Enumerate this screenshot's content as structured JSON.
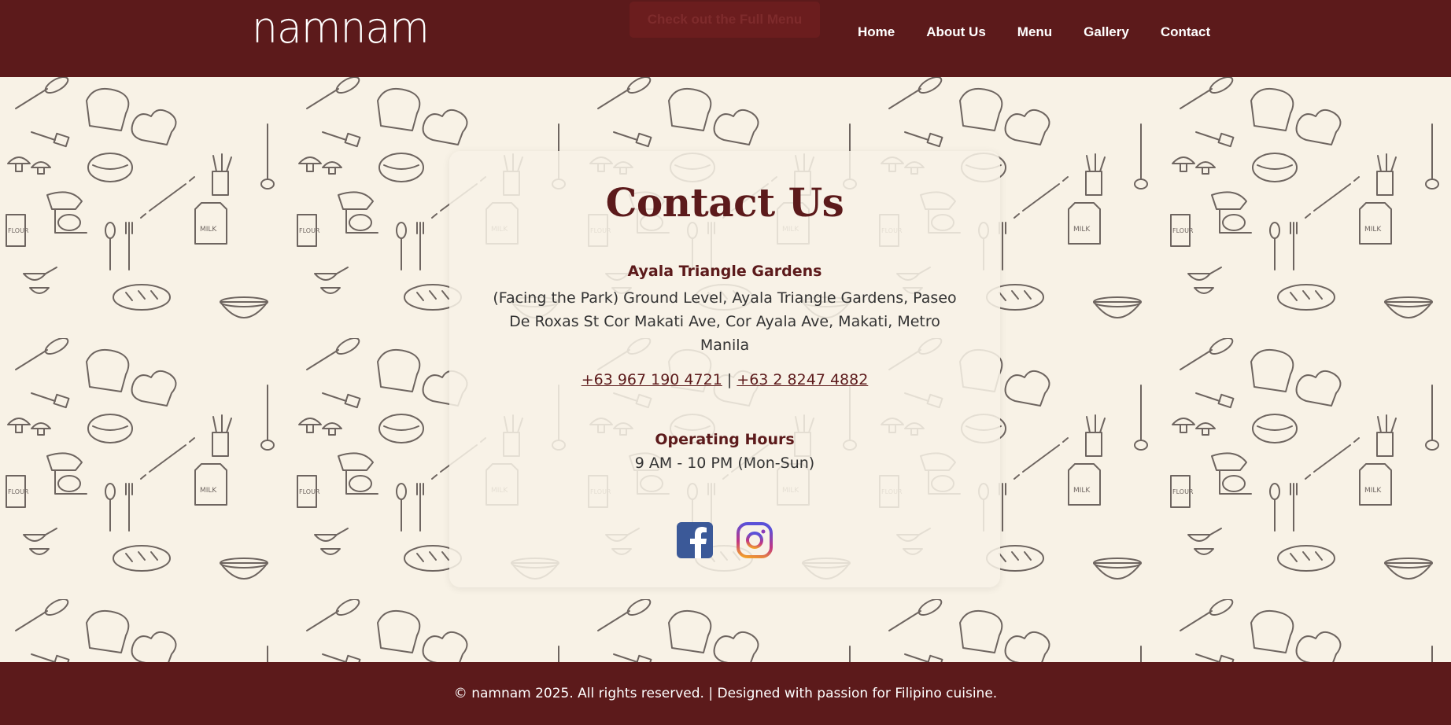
{
  "header": {
    "logo": "namnam",
    "menu_button": "Check out the Full Menu",
    "nav": [
      "Home",
      "About Us",
      "Menu",
      "Gallery",
      "Contact"
    ]
  },
  "contact": {
    "title": "Contact Us",
    "location_name": "Ayala Triangle Gardens",
    "address": "(Facing the Park) Ground Level, Ayala Triangle Gardens, Paseo De Roxas St Cor Makati Ave, Cor Ayala Ave, Makati, Metro Manila",
    "phone_1": "+63 967 190 4721",
    "phone_separator": "|",
    "phone_2": "+63 2 8247 4882",
    "hours_title": "Operating Hours",
    "hours": "9 AM - 10 PM (Mon-Sun)",
    "social": [
      "facebook-icon",
      "instagram-icon"
    ]
  },
  "footer": {
    "text": "© namnam 2025. All rights reserved. | Designed with passion for Filipino cuisine."
  },
  "colors": {
    "brand": "#5c1a1b",
    "background": "#f8f2e6",
    "facebook": "#3b5998"
  }
}
